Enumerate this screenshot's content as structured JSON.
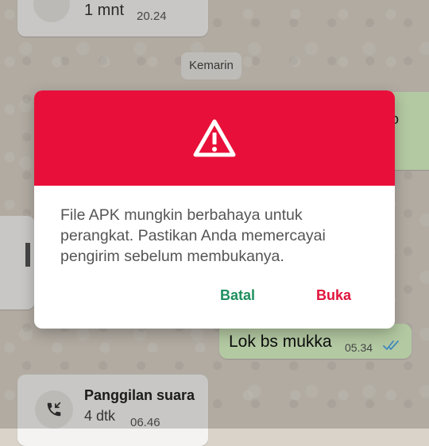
{
  "chat": {
    "call_top": {
      "duration": "1 mnt",
      "time": "20.24"
    },
    "date_chip": "Kemarin",
    "out_top_fragment": "o",
    "out_message": {
      "text": "Lok bs mukka",
      "time": "05.34"
    },
    "call_bottom": {
      "title": "Panggilan suara",
      "duration": "4 dtk",
      "time": "06.46"
    }
  },
  "dialog": {
    "message": "File APK mungkin berbahaya untuk perangkat. Pastikan Anda memercayai pengirim sebelum membukanya.",
    "cancel_label": "Batal",
    "open_label": "Buka",
    "icon": "warning-triangle-icon"
  },
  "colors": {
    "dialog_header": "#e8103a",
    "cancel_button": "#1f8f5e",
    "open_button": "#e0143c",
    "outgoing_bubble": "#dbf6c6",
    "read_ticks": "#4fa8e8"
  }
}
